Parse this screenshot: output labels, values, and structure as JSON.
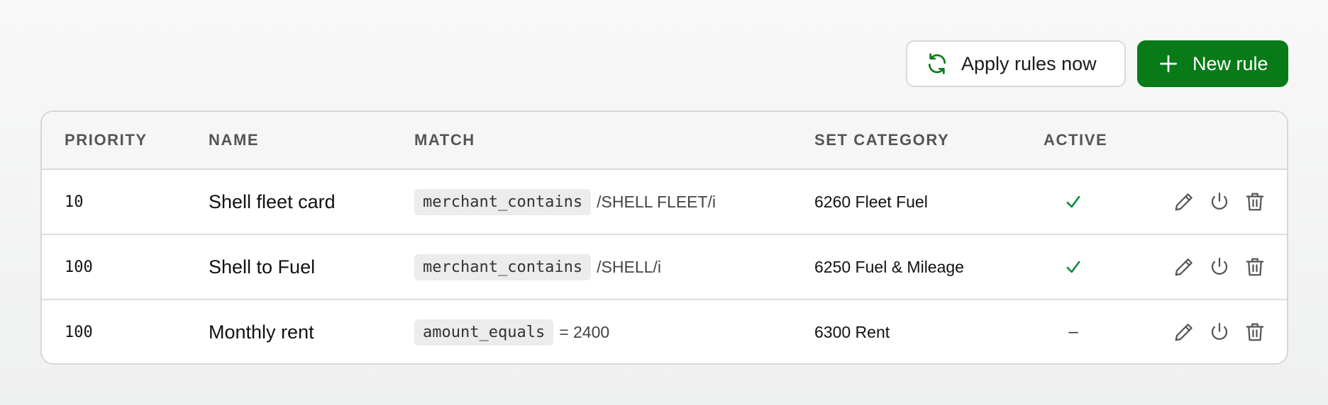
{
  "toolbar": {
    "apply_label": "Apply rules now",
    "new_rule_label": "New rule"
  },
  "table": {
    "headers": {
      "priority": "PRIORITY",
      "name": "NAME",
      "match": "MATCH",
      "set_category": "SET CATEGORY",
      "active": "ACTIVE"
    },
    "rows": [
      {
        "priority": "10",
        "name": "Shell fleet card",
        "match_type": "merchant_contains",
        "match_value": "/SHELL FLEET/i",
        "category": "6260 Fleet Fuel",
        "active": true,
        "active_display": ""
      },
      {
        "priority": "100",
        "name": "Shell to Fuel",
        "match_type": "merchant_contains",
        "match_value": "/SHELL/i",
        "category": "6250 Fuel & Mileage",
        "active": true,
        "active_display": ""
      },
      {
        "priority": "100",
        "name": "Monthly rent",
        "match_type": "amount_equals",
        "match_value": "= 2400",
        "category": "6300 Rent",
        "active": false,
        "active_display": "–"
      }
    ]
  },
  "icons": {
    "apply": "refresh-icon",
    "new_rule": "plus-icon",
    "active": "check-icon",
    "edit": "pencil-icon",
    "toggle": "power-icon",
    "delete": "trash-icon"
  },
  "colors": {
    "primary": "#087a18",
    "check": "#0a8a3a",
    "header_text": "#555555"
  }
}
